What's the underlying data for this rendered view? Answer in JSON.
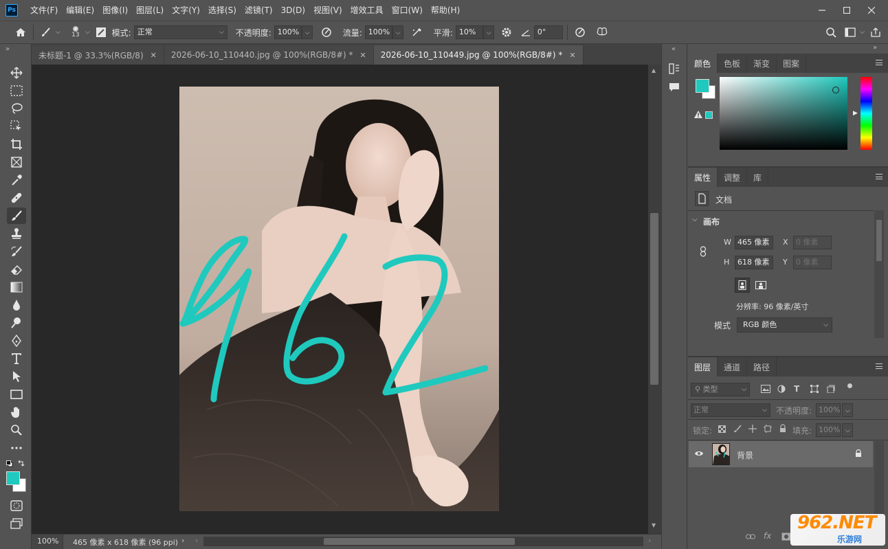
{
  "app": {
    "logo": "Ps"
  },
  "menu": [
    "文件(F)",
    "编辑(E)",
    "图像(I)",
    "图层(L)",
    "文字(Y)",
    "选择(S)",
    "滤镜(T)",
    "3D(D)",
    "视图(V)",
    "增效工具",
    "窗口(W)",
    "帮助(H)"
  ],
  "options": {
    "brush_size": "13",
    "mode_label": "模式:",
    "mode_value": "正常",
    "opacity_label": "不透明度:",
    "opacity_value": "100%",
    "flow_label": "流量:",
    "flow_value": "100%",
    "smooth_label": "平滑:",
    "smooth_value": "10%",
    "angle_value": "0°"
  },
  "tabs": [
    {
      "label": "未标题-1 @ 33.3%(RGB/8)",
      "active": false
    },
    {
      "label": "2026-06-10_110440.jpg @ 100%(RGB/8#) *",
      "active": false
    },
    {
      "label": "2026-06-10_110449.jpg @ 100%(RGB/8#) *",
      "active": true
    }
  ],
  "canvas": {
    "drawn_text": "962",
    "stroke_color": "#1fc9bd"
  },
  "colors": {
    "foreground": "#1fc9bd",
    "background": "#ffffff",
    "accent": "#1fc9bd"
  },
  "color_panel": {
    "tabs": [
      "颜色",
      "色板",
      "渐变",
      "图案"
    ]
  },
  "properties_panel": {
    "tabs": [
      "属性",
      "调整",
      "库"
    ],
    "doc_label": "文档",
    "section": "画布",
    "w_label": "W",
    "w_value": "465 像素",
    "h_label": "H",
    "h_value": "618 像素",
    "x_label": "X",
    "x_placeholder": "0 像素",
    "y_label": "Y",
    "y_placeholder": "0 像素",
    "resolution": "分辨率: 96 像素/英寸",
    "mode_label": "模式",
    "mode_value": "RGB 颜色"
  },
  "layers_panel": {
    "tabs": [
      "图层",
      "通道",
      "路径"
    ],
    "filter_kind": "类型",
    "blend_mode": "正常",
    "opacity_label": "不透明度:",
    "opacity_value": "100%",
    "lock_label": "锁定:",
    "fill_label": "填充:",
    "fill_value": "100%",
    "layers": [
      {
        "name": "背景",
        "locked": true,
        "visible": true
      }
    ]
  },
  "status": {
    "zoom": "100%",
    "doc_info": "465 像素 x 618 像素 (96 ppi)"
  },
  "watermark": {
    "brand": "962.NET",
    "sub": "乐游网"
  }
}
